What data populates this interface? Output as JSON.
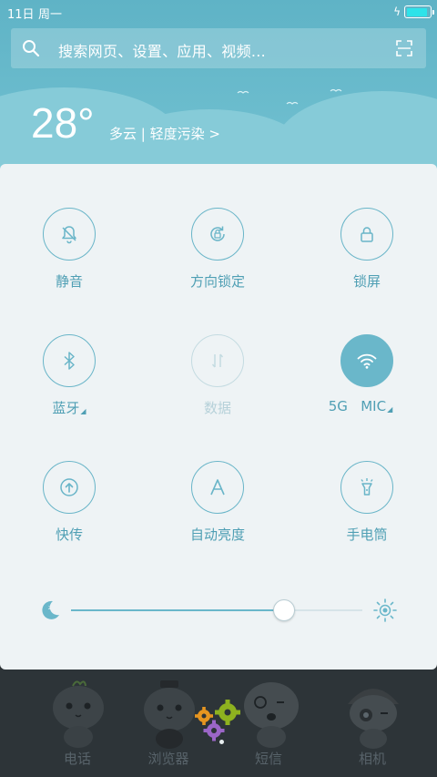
{
  "status_bar": {
    "date": "11日",
    "weekday": "周一",
    "battery_level": 0.9,
    "charging_icon": "bolt-icon"
  },
  "search": {
    "placeholder": "搜索网页、设置、应用、视频..."
  },
  "weather": {
    "temperature": "28°",
    "description": "多云 | 轻度污染 >"
  },
  "toggles": [
    {
      "label": "静音",
      "icon": "mute-bell-icon",
      "state": "off"
    },
    {
      "label": "方向锁定",
      "icon": "rotation-lock-icon",
      "state": "off"
    },
    {
      "label": "锁屏",
      "icon": "lock-icon",
      "state": "off"
    },
    {
      "label": "蓝牙",
      "icon": "bluetooth-icon",
      "state": "off"
    },
    {
      "label": "数据",
      "icon": "mobile-data-icon",
      "state": "disabled"
    },
    {
      "label": "5G   MIC",
      "icon": "wifi-icon",
      "state": "on"
    },
    {
      "label": "快传",
      "icon": "quick-transfer-icon",
      "state": "off"
    },
    {
      "label": "自动亮度",
      "icon": "auto-brightness-icon",
      "state": "off"
    },
    {
      "label": "手电筒",
      "icon": "flashlight-icon",
      "state": "off"
    }
  ],
  "brightness": {
    "level": 0.73,
    "low_icon": "moon-icon",
    "high_icon": "sun-icon"
  },
  "dock": [
    {
      "label": "电话"
    },
    {
      "label": "浏览器"
    },
    {
      "label": "短信"
    },
    {
      "label": "相机"
    }
  ],
  "colors": {
    "accent": "#6ab7ca",
    "panel_bg": "#eef3f5",
    "header_bg": "#5fb3c6"
  }
}
